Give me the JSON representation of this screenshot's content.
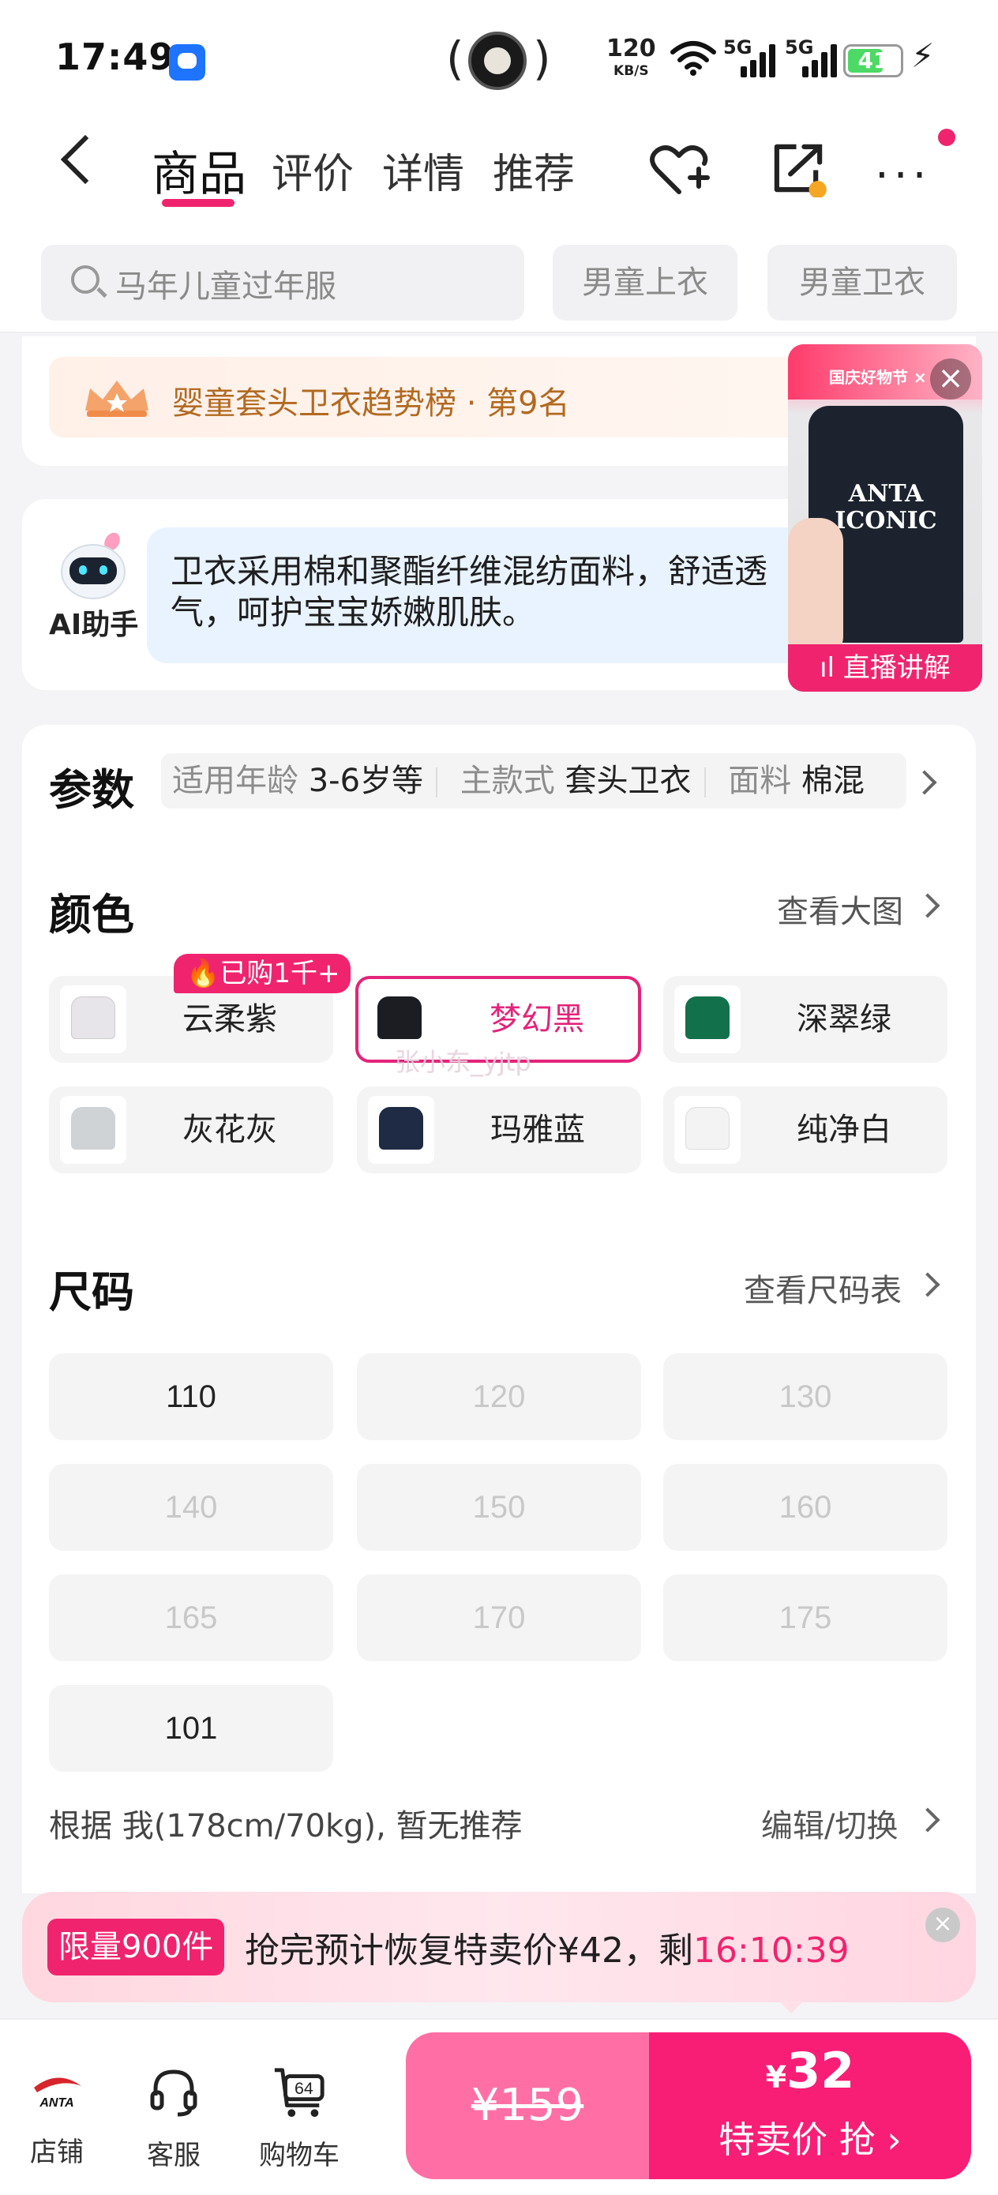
{
  "status_bar": {
    "time": "17:49",
    "net_speed": "120",
    "net_unit": "KB/S",
    "signal1": "5G",
    "signal2": "5G",
    "battery": "41"
  },
  "nav": {
    "tabs": [
      "商品",
      "评价",
      "详情",
      "推荐"
    ],
    "active_tab": "商品"
  },
  "search": {
    "placeholder": "马年儿童过年服",
    "chips": [
      "男童上衣",
      "男童卫衣"
    ]
  },
  "rank": {
    "text": "婴童套头卫衣趋势榜 · 第9名"
  },
  "ai": {
    "label": "AI助手",
    "message": "卫衣采用棉和聚酯纤维混纺面料，舒适透气，呵护宝宝娇嫩肌肤。"
  },
  "live": {
    "banner": "国庆好物节 ×",
    "shirt_text": "ANTA\nICONIC",
    "label": "直播讲解"
  },
  "params": {
    "title": "参数",
    "items": [
      {
        "key": "适用年龄",
        "value": "3-6岁等"
      },
      {
        "key": "主款式",
        "value": "套头卫衣"
      },
      {
        "key": "面料",
        "value": "棉混"
      }
    ]
  },
  "colors": {
    "title": "颜色",
    "link": "查看大图",
    "badge": "已购1千+",
    "options": [
      {
        "label": "云柔紫",
        "swatch": "#e7e5ea",
        "selected": false
      },
      {
        "label": "梦幻黑",
        "swatch": "#1b1d22",
        "selected": true
      },
      {
        "label": "深翠绿",
        "swatch": "#12704a",
        "selected": false
      },
      {
        "label": "灰花灰",
        "swatch": "#cfd3d6",
        "selected": false
      },
      {
        "label": "玛雅蓝",
        "swatch": "#1f2a44",
        "selected": false
      },
      {
        "label": "纯净白",
        "swatch": "#f3f3f3",
        "selected": false
      }
    ],
    "watermark": "张小东_yjtp"
  },
  "sizes": {
    "title": "尺码",
    "link": "查看尺码表",
    "options": [
      {
        "label": "110",
        "available": true
      },
      {
        "label": "120",
        "available": false
      },
      {
        "label": "130",
        "available": false
      },
      {
        "label": "140",
        "available": false
      },
      {
        "label": "150",
        "available": false
      },
      {
        "label": "160",
        "available": false
      },
      {
        "label": "165",
        "available": false
      },
      {
        "label": "170",
        "available": false
      },
      {
        "label": "175",
        "available": false
      },
      {
        "label": "101",
        "available": true
      }
    ],
    "recommend": "根据 我(178cm/70kg), 暂无推荐",
    "edit_link": "编辑/切换"
  },
  "promo": {
    "tag": "限量900件",
    "text": "抢完预计恢复特卖价¥42，剩",
    "countdown": "16:10:39"
  },
  "bottom": {
    "shop": "店铺",
    "shop_logo": "ANTA",
    "service": "客服",
    "cart": "购物车",
    "cart_count": "64",
    "original_price": "¥159",
    "currency": "¥",
    "sale_price": "32",
    "sale_label": "特卖价 抢"
  },
  "colors_theme": {
    "accent": "#f0246e"
  }
}
